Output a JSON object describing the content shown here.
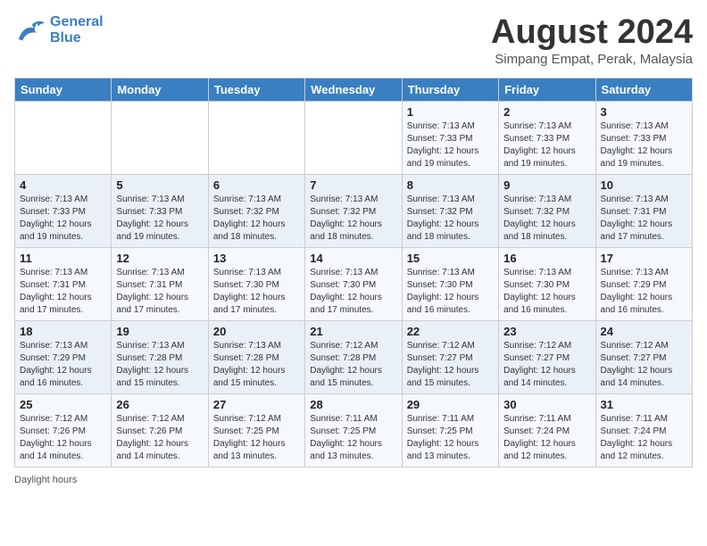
{
  "header": {
    "logo_line1": "General",
    "logo_line2": "Blue",
    "month_year": "August 2024",
    "location": "Simpang Empat, Perak, Malaysia"
  },
  "days_of_week": [
    "Sunday",
    "Monday",
    "Tuesday",
    "Wednesday",
    "Thursday",
    "Friday",
    "Saturday"
  ],
  "weeks": [
    [
      {
        "day": "",
        "info": ""
      },
      {
        "day": "",
        "info": ""
      },
      {
        "day": "",
        "info": ""
      },
      {
        "day": "",
        "info": ""
      },
      {
        "day": "1",
        "info": "Sunrise: 7:13 AM\nSunset: 7:33 PM\nDaylight: 12 hours\nand 19 minutes."
      },
      {
        "day": "2",
        "info": "Sunrise: 7:13 AM\nSunset: 7:33 PM\nDaylight: 12 hours\nand 19 minutes."
      },
      {
        "day": "3",
        "info": "Sunrise: 7:13 AM\nSunset: 7:33 PM\nDaylight: 12 hours\nand 19 minutes."
      }
    ],
    [
      {
        "day": "4",
        "info": "Sunrise: 7:13 AM\nSunset: 7:33 PM\nDaylight: 12 hours\nand 19 minutes."
      },
      {
        "day": "5",
        "info": "Sunrise: 7:13 AM\nSunset: 7:33 PM\nDaylight: 12 hours\nand 19 minutes."
      },
      {
        "day": "6",
        "info": "Sunrise: 7:13 AM\nSunset: 7:32 PM\nDaylight: 12 hours\nand 18 minutes."
      },
      {
        "day": "7",
        "info": "Sunrise: 7:13 AM\nSunset: 7:32 PM\nDaylight: 12 hours\nand 18 minutes."
      },
      {
        "day": "8",
        "info": "Sunrise: 7:13 AM\nSunset: 7:32 PM\nDaylight: 12 hours\nand 18 minutes."
      },
      {
        "day": "9",
        "info": "Sunrise: 7:13 AM\nSunset: 7:32 PM\nDaylight: 12 hours\nand 18 minutes."
      },
      {
        "day": "10",
        "info": "Sunrise: 7:13 AM\nSunset: 7:31 PM\nDaylight: 12 hours\nand 17 minutes."
      }
    ],
    [
      {
        "day": "11",
        "info": "Sunrise: 7:13 AM\nSunset: 7:31 PM\nDaylight: 12 hours\nand 17 minutes."
      },
      {
        "day": "12",
        "info": "Sunrise: 7:13 AM\nSunset: 7:31 PM\nDaylight: 12 hours\nand 17 minutes."
      },
      {
        "day": "13",
        "info": "Sunrise: 7:13 AM\nSunset: 7:30 PM\nDaylight: 12 hours\nand 17 minutes."
      },
      {
        "day": "14",
        "info": "Sunrise: 7:13 AM\nSunset: 7:30 PM\nDaylight: 12 hours\nand 17 minutes."
      },
      {
        "day": "15",
        "info": "Sunrise: 7:13 AM\nSunset: 7:30 PM\nDaylight: 12 hours\nand 16 minutes."
      },
      {
        "day": "16",
        "info": "Sunrise: 7:13 AM\nSunset: 7:30 PM\nDaylight: 12 hours\nand 16 minutes."
      },
      {
        "day": "17",
        "info": "Sunrise: 7:13 AM\nSunset: 7:29 PM\nDaylight: 12 hours\nand 16 minutes."
      }
    ],
    [
      {
        "day": "18",
        "info": "Sunrise: 7:13 AM\nSunset: 7:29 PM\nDaylight: 12 hours\nand 16 minutes."
      },
      {
        "day": "19",
        "info": "Sunrise: 7:13 AM\nSunset: 7:28 PM\nDaylight: 12 hours\nand 15 minutes."
      },
      {
        "day": "20",
        "info": "Sunrise: 7:13 AM\nSunset: 7:28 PM\nDaylight: 12 hours\nand 15 minutes."
      },
      {
        "day": "21",
        "info": "Sunrise: 7:12 AM\nSunset: 7:28 PM\nDaylight: 12 hours\nand 15 minutes."
      },
      {
        "day": "22",
        "info": "Sunrise: 7:12 AM\nSunset: 7:27 PM\nDaylight: 12 hours\nand 15 minutes."
      },
      {
        "day": "23",
        "info": "Sunrise: 7:12 AM\nSunset: 7:27 PM\nDaylight: 12 hours\nand 14 minutes."
      },
      {
        "day": "24",
        "info": "Sunrise: 7:12 AM\nSunset: 7:27 PM\nDaylight: 12 hours\nand 14 minutes."
      }
    ],
    [
      {
        "day": "25",
        "info": "Sunrise: 7:12 AM\nSunset: 7:26 PM\nDaylight: 12 hours\nand 14 minutes."
      },
      {
        "day": "26",
        "info": "Sunrise: 7:12 AM\nSunset: 7:26 PM\nDaylight: 12 hours\nand 14 minutes."
      },
      {
        "day": "27",
        "info": "Sunrise: 7:12 AM\nSunset: 7:25 PM\nDaylight: 12 hours\nand 13 minutes."
      },
      {
        "day": "28",
        "info": "Sunrise: 7:11 AM\nSunset: 7:25 PM\nDaylight: 12 hours\nand 13 minutes."
      },
      {
        "day": "29",
        "info": "Sunrise: 7:11 AM\nSunset: 7:25 PM\nDaylight: 12 hours\nand 13 minutes."
      },
      {
        "day": "30",
        "info": "Sunrise: 7:11 AM\nSunset: 7:24 PM\nDaylight: 12 hours\nand 12 minutes."
      },
      {
        "day": "31",
        "info": "Sunrise: 7:11 AM\nSunset: 7:24 PM\nDaylight: 12 hours\nand 12 minutes."
      }
    ]
  ],
  "footer": "Daylight hours"
}
